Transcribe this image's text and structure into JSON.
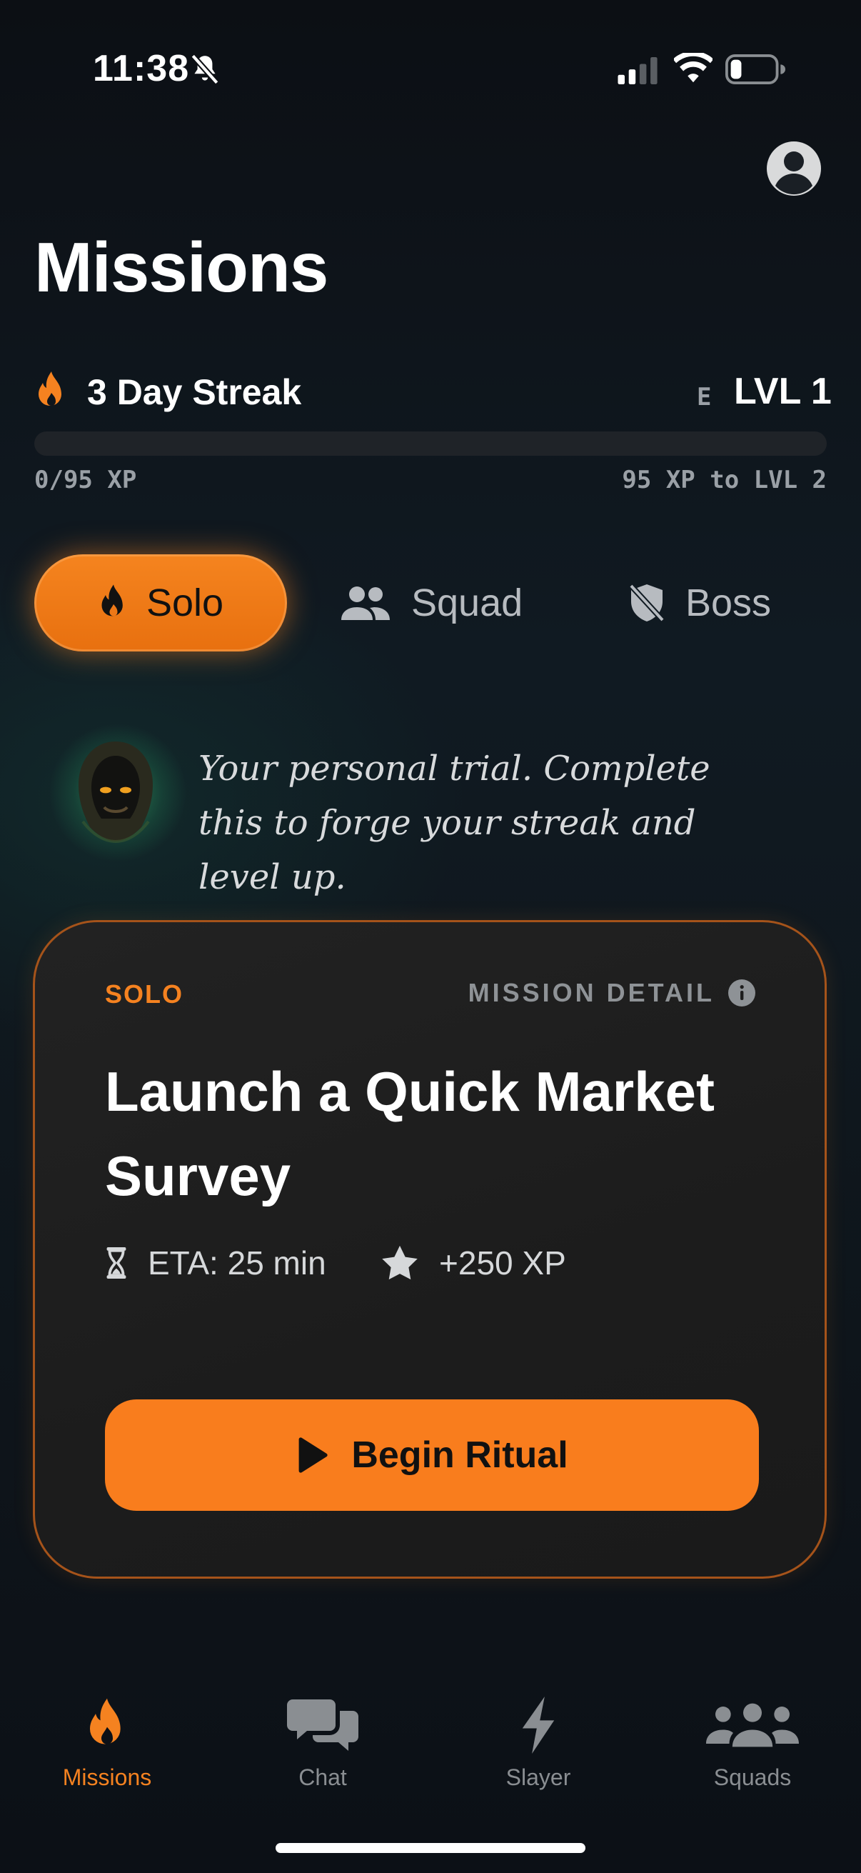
{
  "status_bar": {
    "time": "11:38",
    "battery_level": 0.25
  },
  "header": {
    "title": "Missions"
  },
  "streak": {
    "label": "3 Day Streak",
    "rank_letter": "E",
    "level_label": "LVL 1",
    "xp_progress": 0,
    "xp_current_label": "0/95 XP",
    "xp_next_label": "95 XP to LVL 2"
  },
  "tabs": [
    {
      "label": "Solo",
      "icon": "flame-icon",
      "active": true
    },
    {
      "label": "Squad",
      "icon": "people-icon",
      "active": false
    },
    {
      "label": "Boss",
      "icon": "shield-slash-icon",
      "active": false
    }
  ],
  "intro": {
    "text": "Your personal trial. Complete this to forge your streak and level up."
  },
  "mission_card": {
    "kicker": "SOLO",
    "detail_label": "MISSION DETAIL",
    "title": "Launch a Quick Market Survey",
    "eta": "ETA: 25 min",
    "xp_reward": "+250 XP",
    "cta_label": "Begin Ritual"
  },
  "bottom_nav": [
    {
      "label": "Missions",
      "icon": "flame-icon",
      "active": true
    },
    {
      "label": "Chat",
      "icon": "chat-bubbles-icon",
      "active": false
    },
    {
      "label": "Slayer",
      "icon": "bolt-icon",
      "active": false
    },
    {
      "label": "Squads",
      "icon": "group-icon",
      "active": false
    }
  ],
  "colors": {
    "accent": "#f58220",
    "background": "#0d1116",
    "card": "#1f1f1f",
    "muted_text": "#9aa0a6"
  }
}
